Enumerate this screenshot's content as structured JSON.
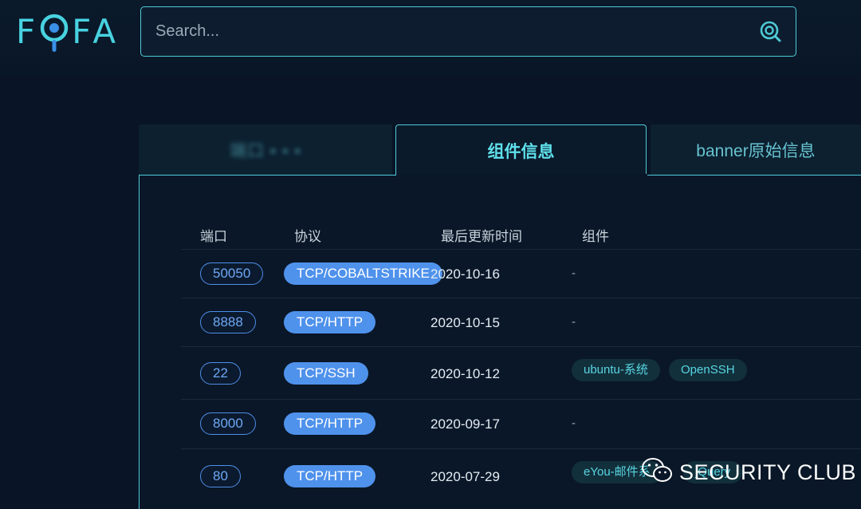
{
  "app": {
    "logo_text": "FOFA"
  },
  "search": {
    "placeholder": "Search..."
  },
  "tabs": [
    {
      "label": "端口 ▪ ▪ ▪"
    },
    {
      "label": "组件信息"
    },
    {
      "label": "banner原始信息"
    }
  ],
  "table": {
    "headers": [
      "端口",
      "协议",
      "最后更新时间",
      "组件"
    ],
    "rows": [
      {
        "port": "50050",
        "protocol": "TCP/COBALTSTRIKE",
        "date": "2020-10-16",
        "components": [],
        "dash": "-"
      },
      {
        "port": "8888",
        "protocol": "TCP/HTTP",
        "date": "2020-10-15",
        "components": [],
        "dash": "-"
      },
      {
        "port": "22",
        "protocol": "TCP/SSH",
        "date": "2020-10-12",
        "components": [
          "ubuntu-系统",
          "OpenSSH"
        ],
        "dash": ""
      },
      {
        "port": "8000",
        "protocol": "TCP/HTTP",
        "date": "2020-09-17",
        "components": [],
        "dash": "-"
      },
      {
        "port": "80",
        "protocol": "TCP/HTTP",
        "date": "2020-07-29",
        "components": [
          "eYou-邮件系",
          "jQuery"
        ],
        "dash": ""
      }
    ]
  },
  "watermark": {
    "text": "SECURITY CLUB",
    "icon": "wechat-icon"
  },
  "colors": {
    "accent": "#4fcad6",
    "port_border": "#4f8ee8",
    "protocol_bg": "#4f92ec",
    "background": "#091426"
  }
}
